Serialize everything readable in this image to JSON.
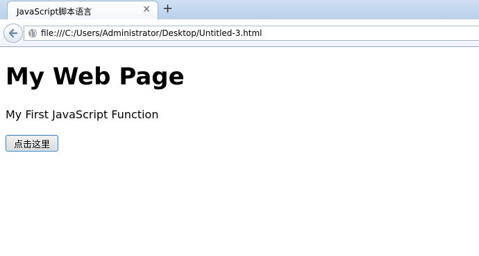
{
  "browser": {
    "tab": {
      "title": "JavaScript脚本语言",
      "close_glyph": "✕"
    },
    "new_tab_glyph": "+",
    "address": {
      "url": "file:///C:/Users/Administrator/Desktop/Untitled-3.html"
    }
  },
  "page": {
    "heading": "My Web Page",
    "paragraph": "My First JavaScript Function",
    "button_label": "点击这里"
  },
  "colors": {
    "tab_strip": "#b9d1ea",
    "button_border": "#3c7fb1"
  }
}
